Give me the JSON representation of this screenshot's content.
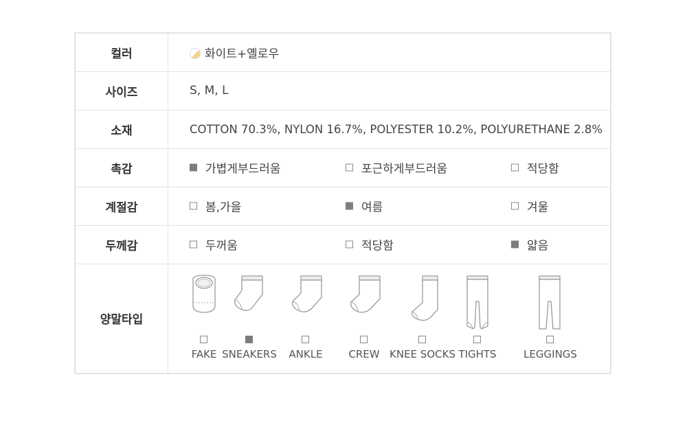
{
  "rows": {
    "color": {
      "label": "컬러",
      "value": "화이트+옐로우",
      "swatch_colors": [
        "#ffffff",
        "#f3d68a"
      ]
    },
    "size": {
      "label": "사이즈",
      "value": "S, M, L"
    },
    "material": {
      "label": "소재",
      "value": "COTTON 70.3%, NYLON 16.7%, POLYESTER 10.2%, POLYURETHANE 2.8%"
    },
    "touch": {
      "label": "촉감",
      "options": [
        {
          "label": "가볍게부드러움",
          "checked": true
        },
        {
          "label": "포근하게부드러움",
          "checked": false
        },
        {
          "label": "적당함",
          "checked": false
        }
      ]
    },
    "season": {
      "label": "계절감",
      "options": [
        {
          "label": "봄,가을",
          "checked": false
        },
        {
          "label": "여름",
          "checked": true
        },
        {
          "label": "겨울",
          "checked": false
        }
      ]
    },
    "thickness": {
      "label": "두께감",
      "options": [
        {
          "label": "두꺼움",
          "checked": false
        },
        {
          "label": "적당함",
          "checked": false
        },
        {
          "label": "얇음",
          "checked": true
        }
      ]
    },
    "sock_type": {
      "label": "양말타입",
      "options": [
        {
          "label": "FAKE",
          "checked": false,
          "icon": "fake-sock-icon"
        },
        {
          "label": "SNEAKERS",
          "checked": true,
          "icon": "sneakers-sock-icon"
        },
        {
          "label": "ANKLE",
          "checked": false,
          "icon": "ankle-sock-icon"
        },
        {
          "label": "CREW",
          "checked": false,
          "icon": "crew-sock-icon"
        },
        {
          "label": "KNEE SOCKS",
          "checked": false,
          "icon": "knee-sock-icon"
        },
        {
          "label": "TIGHTS",
          "checked": false,
          "icon": "tights-icon"
        },
        {
          "label": "LEGGINGS",
          "checked": false,
          "icon": "leggings-icon"
        }
      ]
    }
  },
  "colors": {
    "border": "#e3e3e3",
    "checked": "#7d7d7d",
    "text": "#333333"
  }
}
